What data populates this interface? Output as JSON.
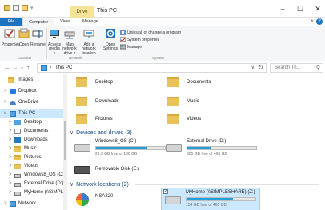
{
  "title_bar": {
    "context_tab": "Drive Tools",
    "window_title": "This PC",
    "minimize": "–",
    "maximize": "☐",
    "close": "✕"
  },
  "ribbon_tabs": [
    "File",
    "Computer",
    "View",
    "Manage"
  ],
  "ribbon": {
    "location": {
      "properties": "Properties",
      "open": "Open",
      "rename": "Rename",
      "label": "Location"
    },
    "network": {
      "access_media": "Access media ▾",
      "map_network_drive": "Map network drive ▾",
      "add_network_location": "Add a network location",
      "label": "Network"
    },
    "system": {
      "open_settings": "Open Settings",
      "uninstall": "Uninstall or change a program",
      "system_properties": "System properties",
      "manage": "Manage",
      "label": "System"
    }
  },
  "address": {
    "back": "←",
    "forward": "→",
    "recent": "⌄",
    "up": "↑",
    "path": "This PC",
    "refresh": "↻",
    "search_placeholder": "Search Th...",
    "search_icon": "⚲"
  },
  "nav_pane": [
    {
      "label": "images",
      "arrow": ""
    },
    {
      "label": "Dropbox",
      "arrow": ">"
    },
    {
      "label": "OneDrive",
      "arrow": ">"
    },
    {
      "label": "This PC",
      "arrow": "∨",
      "selected": true
    },
    {
      "label": "Desktop",
      "arrow": ">"
    },
    {
      "label": "Documents",
      "arrow": ">"
    },
    {
      "label": "Downloads",
      "arrow": ">"
    },
    {
      "label": "Music",
      "arrow": ">"
    },
    {
      "label": "Pictures",
      "arrow": ">"
    },
    {
      "label": "Videos",
      "arrow": ">"
    },
    {
      "label": "Windows8_OS (C:)",
      "arrow": ">"
    },
    {
      "label": "External Drive (D:)",
      "arrow": ">"
    },
    {
      "label": "MyHome (\\\\SIMPLE",
      "arrow": ">"
    },
    {
      "label": "Network",
      "arrow": ">"
    }
  ],
  "folders": [
    {
      "name": "Desktop",
      "icon": "desktop-folder-icon"
    },
    {
      "name": "Documents",
      "icon": "documents-folder-icon"
    },
    {
      "name": "Downloads",
      "icon": "downloads-folder-icon"
    },
    {
      "name": "Music",
      "icon": "music-folder-icon"
    },
    {
      "name": "Pictures",
      "icon": "pictures-folder-icon"
    },
    {
      "name": "Videos",
      "icon": "videos-folder-icon"
    }
  ],
  "sections": {
    "devices": "Devices and drives (3)",
    "network": "Network locations (2)"
  },
  "drives": [
    {
      "name": "Windows8_OS (C:)",
      "free": "26.3 GB free of 100 GB",
      "used_fraction": 0.74
    },
    {
      "name": "External Drive (D:)",
      "free": "305 GB free of 465 GB",
      "used_fraction": 0.34
    },
    {
      "name": "Removable Disk (E:)",
      "free": "",
      "used_fraction": null
    }
  ],
  "network_locations": [
    {
      "name": "NSA320",
      "free": "",
      "used_fraction": null
    },
    {
      "name": "MyHome (\\\\SIMPLESHARE) (Z:)",
      "free": "154 GB free of 465 GB",
      "used_fraction": 0.67,
      "selected": true
    }
  ],
  "colors": {
    "accent": "#1e73be",
    "bar_fill": "#26a0da",
    "selection": "#cce8ff",
    "section_header": "#1e4e8c"
  }
}
